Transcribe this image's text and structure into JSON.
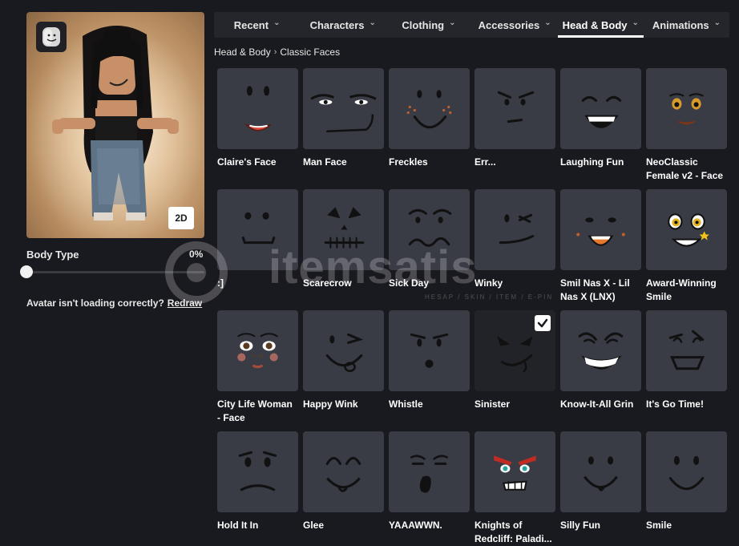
{
  "avatar": {
    "view_toggle": "2D",
    "thumb_icon": "avatar-head-icon"
  },
  "body_type": {
    "label": "Body Type",
    "value_text": "0%",
    "value": 0
  },
  "loading": {
    "text": "Avatar isn't loading correctly?",
    "redraw": "Redraw"
  },
  "tabs": [
    {
      "label": "Recent"
    },
    {
      "label": "Characters"
    },
    {
      "label": "Clothing"
    },
    {
      "label": "Accessories"
    },
    {
      "label": "Head & Body",
      "active": true
    },
    {
      "label": "Animations"
    }
  ],
  "breadcrumb": {
    "parent": "Head & Body",
    "current": "Classic Faces"
  },
  "items": [
    {
      "name": "Claire's Face",
      "icon": "claires-face-icon"
    },
    {
      "name": "Man Face",
      "icon": "man-face-icon"
    },
    {
      "name": "Freckles",
      "icon": "freckles-face-icon"
    },
    {
      "name": "Err...",
      "icon": "err-face-icon"
    },
    {
      "name": "Laughing Fun",
      "icon": "laughing-fun-face-icon"
    },
    {
      "name": "NeoClassic Female v2 - Face",
      "icon": "neoclassic-female-face-icon"
    },
    {
      "name": ":]",
      "icon": "smirk-face-icon"
    },
    {
      "name": "Scarecrow",
      "icon": "scarecrow-face-icon"
    },
    {
      "name": "Sick Day",
      "icon": "sick-day-face-icon"
    },
    {
      "name": "Winky",
      "icon": "winky-face-icon"
    },
    {
      "name": "Smil Nas X - Lil Nas X (LNX)",
      "icon": "smil-nas-x-face-icon"
    },
    {
      "name": "Award-Winning Smile",
      "icon": "award-winning-smile-face-icon"
    },
    {
      "name": "City Life Woman - Face",
      "icon": "city-life-woman-face-icon"
    },
    {
      "name": "Happy Wink",
      "icon": "happy-wink-face-icon"
    },
    {
      "name": "Whistle",
      "icon": "whistle-face-icon"
    },
    {
      "name": "Sinister",
      "icon": "sinister-face-icon",
      "selected": true
    },
    {
      "name": "Know-It-All Grin",
      "icon": "know-it-all-grin-face-icon"
    },
    {
      "name": "It's Go Time!",
      "icon": "its-go-time-face-icon"
    },
    {
      "name": "Hold It In",
      "icon": "hold-it-in-face-icon"
    },
    {
      "name": "Glee",
      "icon": "glee-face-icon"
    },
    {
      "name": "YAAAWWN.",
      "icon": "yawn-face-icon"
    },
    {
      "name": "Knights of Redcliff: Paladi...",
      "icon": "knights-of-redcliff-face-icon"
    },
    {
      "name": "Silly Fun",
      "icon": "silly-fun-face-icon"
    },
    {
      "name": "Smile",
      "icon": "smile-face-icon"
    }
  ],
  "watermark": {
    "text": "itemsatis",
    "subtext": "HESAP / SKIN / ITEM / E-PIN"
  },
  "colors": {
    "background": "#191a1f",
    "tile": "#393b45",
    "tile_selected": "#222328",
    "tab_bar": "#25262b",
    "accent": "#ffffff"
  }
}
